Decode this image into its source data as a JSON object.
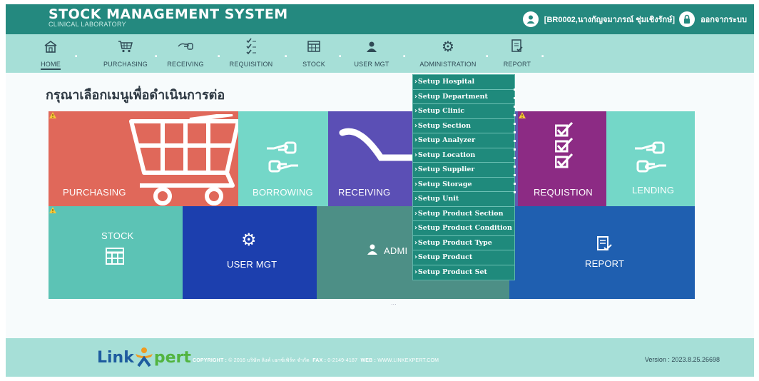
{
  "header": {
    "title": "STOCK MANAGEMENT SYSTEM",
    "subtitle": "CLINICAL LABORATORY",
    "user": "[BR0002,นางกัญจมาภรณ์ ชุ่มเชิงรักษ์]",
    "logout_label": "ออกจากระบบ",
    "background": "#24897f"
  },
  "nav": {
    "background": "#a6dfd7",
    "items": [
      {
        "label": "HOME",
        "icon": "home-icon"
      },
      {
        "label": "PURCHASING",
        "icon": "cart-icon"
      },
      {
        "label": "RECEIVING",
        "icon": "handshake-icon"
      },
      {
        "label": "REQUISITION",
        "icon": "checklist-icon"
      },
      {
        "label": "STOCK",
        "icon": "table-icon"
      },
      {
        "label": "USER MGT",
        "icon": "user-icon"
      },
      {
        "label": "ADMINISTRATION",
        "icon": "gear-icon"
      },
      {
        "label": "REPORT",
        "icon": "report-icon"
      }
    ],
    "active": "HOME"
  },
  "page_title": "กรุณาเลือกเมนูเพื่อดำเนินการต่อ",
  "tiles": {
    "purchasing": {
      "label": "PURCHASING",
      "color": "#e0685a"
    },
    "borrowing": {
      "label": "BORROWING",
      "color": "#74d7c8"
    },
    "receiving": {
      "label": "RECEIVING",
      "color": "#5b4fb5"
    },
    "requisition": {
      "label": "REQUISTION",
      "color": "#8c2b84"
    },
    "lending": {
      "label": "LENDING",
      "color": "#74d7c8"
    },
    "stock": {
      "label": "STOCK",
      "color": "#5cc3b5"
    },
    "user_mgt": {
      "label": "USER MGT",
      "color": "#1c3fae"
    },
    "admin": {
      "label": "ADMI",
      "color": "#4d8f86"
    },
    "report": {
      "label": "REPORT",
      "color": "#1f5fb0"
    }
  },
  "dropdown": {
    "items": [
      "Setup Hospital",
      "Setup Department",
      "Setup Clinic",
      "Setup Section",
      "Setup Analyzer",
      "Setup Location",
      "Setup Supplier",
      "Setup Storage",
      "Setup Unit",
      "Setup Product Section",
      "Setup Product Condition",
      "Setup Product Type",
      "Setup Product",
      "Setup Product Set"
    ]
  },
  "footer": {
    "brand_a": "Link",
    "brand_b": "pert",
    "copyright_label": "COPYRIGHT :",
    "copyright_text": "© 2016 บริษัท ลิงค์ เอกซ์เพิร์ท จำกัด",
    "fax_label": "FAX :",
    "fax": "0-2149-4187",
    "web_label": "WEB :",
    "web": "WWW.LINKEXPERT.COM",
    "version": "Version : 2023.8.25.26698"
  },
  "misc": {
    "loading_dots": "..."
  }
}
